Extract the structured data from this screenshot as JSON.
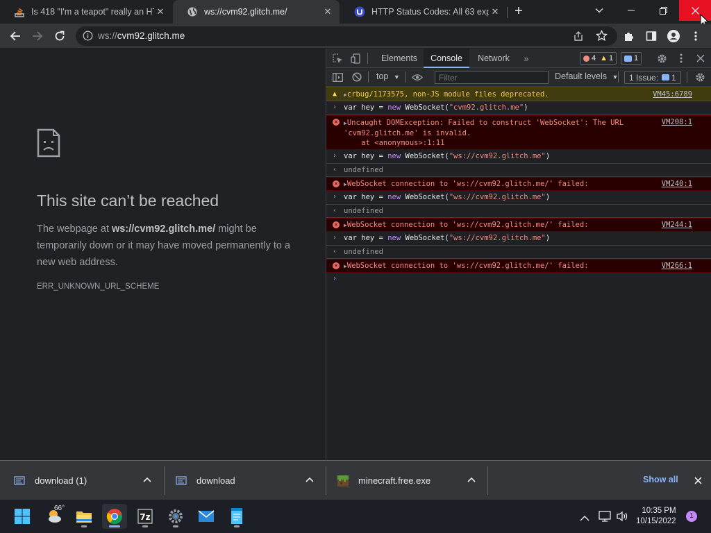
{
  "tabs": [
    {
      "title": "Is 418 \"I'm a teapot\" really an HT",
      "favicon": "stackoverflow-icon"
    },
    {
      "title": "ws://cvm92.glitch.me/",
      "favicon": "globe-icon"
    },
    {
      "title": "HTTP Status Codes: All 63 explain",
      "favicon": "u-logo-icon"
    }
  ],
  "toolbar": {
    "url_scheme": "ws://",
    "url_host": "cvm92.glitch.me"
  },
  "page": {
    "title": "This site can’t be reached",
    "desc_pre": "The webpage at ",
    "desc_url": "ws://cvm92.glitch.me/",
    "desc_post": " might be temporarily down or it may have moved permanently to a new web address.",
    "error_code": "ERR_UNKNOWN_URL_SCHEME"
  },
  "devtools": {
    "tabs": [
      "Elements",
      "Console",
      "Network"
    ],
    "active_tab": "Console",
    "errors_count": "4",
    "warnings_count": "1",
    "messages_count": "1",
    "context": "top",
    "filter_placeholder": "Filter",
    "levels": "Default levels",
    "issues_label": "1 Issue:",
    "issues_count": "1"
  },
  "console": {
    "warn1": {
      "text": "crbug/1173575, non-JS module files deprecated.",
      "src": "VM45:6789"
    },
    "in1": {
      "pre": "var hey = ",
      "kw": "new",
      "fn": " WebSocket(",
      "str": "\"cvm92.glitch.me\"",
      "post": ")"
    },
    "err1": {
      "line1": "Uncaught DOMException: Failed to construct 'WebSocket': The URL",
      "line2": "'cvm92.glitch.me' is invalid.",
      "line3": "    at <anonymous>:1:11",
      "src": "VM208:1"
    },
    "in2": {
      "pre": "var hey = ",
      "kw": "new",
      "fn": " WebSocket(",
      "str": "\"ws://cvm92.glitch.me\"",
      "post": ")"
    },
    "out2": "undefined",
    "err2": {
      "text": "WebSocket connection to 'ws://cvm92.glitch.me/' failed:",
      "src": "VM240:1"
    },
    "in3": {
      "pre": "var hey = ",
      "kw": "new",
      "fn": " WebSocket(",
      "str": "\"ws://cvm92.glitch.me\"",
      "post": ")"
    },
    "out3": "undefined",
    "err3": {
      "text": "WebSocket connection to 'ws://cvm92.glitch.me/' failed:",
      "src": "VM244:1"
    },
    "in4": {
      "pre": "var hey = ",
      "kw": "new",
      "fn": " WebSocket(",
      "str": "\"ws://cvm92.glitch.me\"",
      "post": ")"
    },
    "out4": "undefined",
    "err4": {
      "text": "WebSocket connection to 'ws://cvm92.glitch.me/' failed:",
      "src": "VM266:1"
    }
  },
  "downloads": {
    "items": [
      {
        "name": "download (1)"
      },
      {
        "name": "download"
      },
      {
        "name": "minecraft.free.exe"
      }
    ],
    "show_all": "Show all"
  },
  "taskbar": {
    "weather_temp": "66°",
    "time": "10:35 PM",
    "date": "10/15/2022",
    "notification_count": "1"
  }
}
